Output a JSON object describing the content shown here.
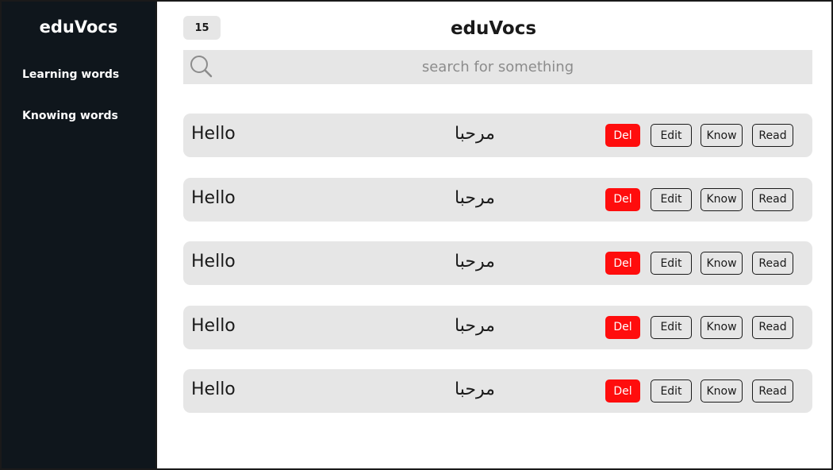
{
  "sidebar": {
    "brand": "eduVocs",
    "items": [
      {
        "label": "Learning words"
      },
      {
        "label": "Knowing words"
      }
    ]
  },
  "header": {
    "count": "15",
    "title": "eduVocs"
  },
  "search": {
    "placeholder": "search for something",
    "icon": "search-icon"
  },
  "actions": {
    "del": "Del",
    "edit": "Edit",
    "know": "Know",
    "read": "Read"
  },
  "words": [
    {
      "english": "Hello",
      "arabic": "مرحبا"
    },
    {
      "english": "Hello",
      "arabic": "مرحبا"
    },
    {
      "english": "Hello",
      "arabic": "مرحبا"
    },
    {
      "english": "Hello",
      "arabic": "مرحبا"
    },
    {
      "english": "Hello",
      "arabic": "مرحبا"
    }
  ],
  "colors": {
    "sidebar_bg": "#0f161c",
    "row_bg": "#e6e6e6",
    "danger": "#ff0d0d"
  }
}
